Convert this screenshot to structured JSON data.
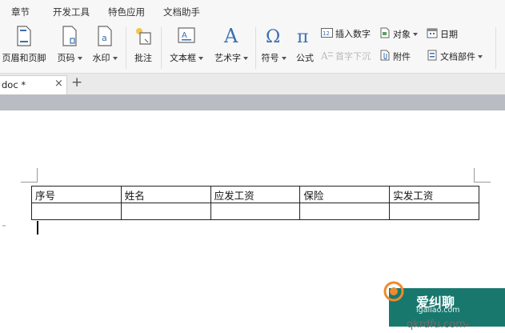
{
  "menu_tabs": [
    "章节",
    "开发工具",
    "特色应用",
    "文档助手"
  ],
  "ribbon": {
    "header_footer": "页眉和页脚",
    "page_number": "页码",
    "watermark": "水印",
    "comment": "批注",
    "text_box": "文本框",
    "word_art": "艺术字",
    "symbol": "符号",
    "formula": "公式",
    "insert_number": "插入数字",
    "drop_cap": "首字下沉",
    "object": "对象",
    "attachment": "附件",
    "date": "日期",
    "doc_parts": "文档部件"
  },
  "doc_tab": {
    "name": "doc *",
    "close": "×",
    "new": "+"
  },
  "table": {
    "headers": [
      "序号",
      "姓名",
      "应发工资",
      "保险",
      "实发工资"
    ],
    "row": [
      "",
      "",
      "",
      "",
      ""
    ]
  },
  "watermark": {
    "site_name": "爱纠聊",
    "url": "igaliao.com",
    "bottom": "qkrdfu.com-"
  },
  "colors": {
    "ribbon_bg": "#f7f7f7",
    "tab_strip_bg": "#eaeaea",
    "gray_band": "#b9bdc3",
    "watermark_green": "#19786e",
    "icon_blue": "#3a6fb0"
  }
}
